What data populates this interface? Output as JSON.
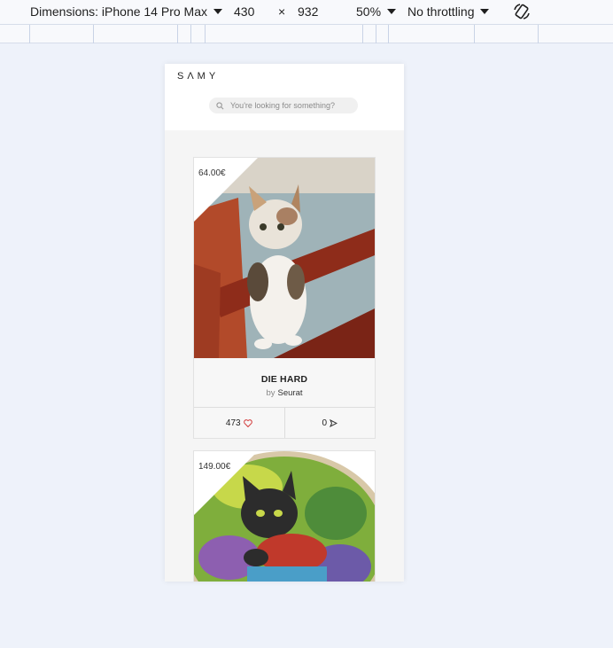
{
  "devtools": {
    "dimensions_label": "Dimensions: iPhone 14 Pro Max",
    "width": "430",
    "times": "×",
    "height": "932",
    "zoom": "50%",
    "throttling": "No throttling"
  },
  "site": {
    "logo": "SΛMY",
    "search_placeholder": "You're looking for something?"
  },
  "cards": [
    {
      "price": "64.00€",
      "title": "DIE HARD",
      "by": "by",
      "artist": "Seurat",
      "likes": "473",
      "shares": "0"
    },
    {
      "price": "149.00€"
    }
  ],
  "colors": {
    "heart": "#d23b3b",
    "page_bg": "#eef2fa"
  }
}
